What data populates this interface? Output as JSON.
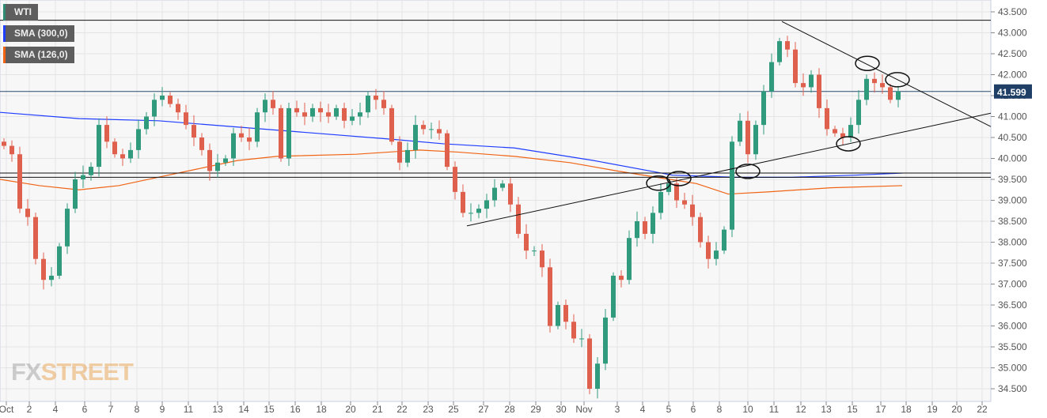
{
  "legend": [
    {
      "label": "WTI",
      "color": "#2e8a72"
    },
    {
      "label": "SMA (300,0)",
      "color": "#1f3dff"
    },
    {
      "label": "SMA (126,0)",
      "color": "#f06414"
    }
  ],
  "watermark": {
    "a": "FX",
    "b": "STREET"
  },
  "chart_data": {
    "type": "candlestick",
    "title": "WTI",
    "ylim": [
      34.3,
      43.8
    ],
    "y_ticks": [
      "43.500",
      "43.000",
      "42.500",
      "42.000",
      "41.500",
      "41.000",
      "40.500",
      "40.000",
      "39.500",
      "39.000",
      "38.500",
      "38.000",
      "37.500",
      "37.000",
      "36.500",
      "36.000",
      "35.500",
      "35.000",
      "34.500"
    ],
    "x_ticks": [
      {
        "label": "Oct",
        "i": 0.3
      },
      {
        "label": "2",
        "i": 3.2
      },
      {
        "label": "4",
        "i": 6.5
      },
      {
        "label": "6",
        "i": 10.2
      },
      {
        "label": "7",
        "i": 13.5
      },
      {
        "label": "8",
        "i": 16.8
      },
      {
        "label": "9",
        "i": 20
      },
      {
        "label": "11",
        "i": 23.3
      },
      {
        "label": "13",
        "i": 27
      },
      {
        "label": "14",
        "i": 30.3
      },
      {
        "label": "15",
        "i": 33.5
      },
      {
        "label": "16",
        "i": 36.8
      },
      {
        "label": "18",
        "i": 40.1
      },
      {
        "label": "20",
        "i": 43.8
      },
      {
        "label": "21",
        "i": 47.2
      },
      {
        "label": "22",
        "i": 50.3
      },
      {
        "label": "23",
        "i": 53.6
      },
      {
        "label": "25",
        "i": 56.8
      },
      {
        "label": "27",
        "i": 60.6
      },
      {
        "label": "28",
        "i": 63.9
      },
      {
        "label": "29",
        "i": 67.2
      },
      {
        "label": "30",
        "i": 70.4
      },
      {
        "label": "Nov",
        "i": 73.3
      },
      {
        "label": "3",
        "i": 77.5
      },
      {
        "label": "4",
        "i": 80.7
      },
      {
        "label": "5",
        "i": 84
      },
      {
        "label": "6",
        "i": 87.1
      },
      {
        "label": "8",
        "i": 90.4
      },
      {
        "label": "10",
        "i": 94
      },
      {
        "label": "11",
        "i": 97.3
      },
      {
        "label": "12",
        "i": 100.7
      },
      {
        "label": "13",
        "i": 103.9
      },
      {
        "label": "15",
        "i": 107.2
      },
      {
        "label": "17",
        "i": 110.8
      },
      {
        "label": "18",
        "i": 114
      },
      {
        "label": "19",
        "i": 117.3
      },
      {
        "label": "20",
        "i": 120.4
      },
      {
        "label": "22",
        "i": 123.6
      }
    ],
    "closes": [
      40.3,
      40.1,
      38.8,
      38.6,
      37.6,
      37.1,
      37.2,
      37.9,
      38.8,
      39.5,
      39.6,
      39.8,
      40.8,
      40.4,
      40.1,
      40.0,
      40.2,
      40.7,
      41.0,
      41.4,
      41.5,
      41.3,
      41.1,
      40.8,
      40.5,
      40.2,
      39.7,
      39.9,
      40.0,
      40.6,
      40.5,
      40.4,
      41.1,
      41.4,
      41.2,
      40.0,
      41.2,
      41.1,
      41.0,
      41.2,
      41.1,
      41.0,
      41.2,
      40.9,
      41.0,
      41.1,
      41.5,
      41.4,
      41.2,
      40.4,
      39.9,
      40.2,
      40.8,
      40.7,
      40.7,
      40.6,
      39.8,
      39.2,
      38.7,
      38.7,
      38.8,
      39.0,
      39.3,
      39.4,
      38.9,
      38.2,
      37.8,
      37.8,
      37.4,
      36.0,
      36.5,
      36.1,
      35.7,
      35.7,
      34.5,
      35.1,
      36.2,
      37.2,
      37.1,
      38.1,
      38.5,
      38.2,
      38.7,
      39.2,
      39.4,
      39.0,
      38.9,
      38.6,
      38.0,
      37.6,
      37.8,
      38.3,
      40.4,
      40.9,
      40.1,
      40.8,
      41.6,
      42.3,
      42.8,
      42.6,
      41.8,
      41.7,
      42.0,
      41.2,
      40.7,
      40.6,
      40.5,
      40.8,
      41.4,
      41.9,
      41.8,
      41.7,
      41.4,
      41.6
    ],
    "series": [
      {
        "name": "SMA (300,0)",
        "color": "#1f3dff",
        "points": [
          [
            -0.5,
            41.1
          ],
          [
            9.5,
            40.95
          ],
          [
            19.5,
            40.9
          ],
          [
            29.5,
            40.75
          ],
          [
            39.5,
            40.6
          ],
          [
            49.5,
            40.45
          ],
          [
            55.5,
            40.35
          ],
          [
            64.5,
            40.25
          ],
          [
            74.5,
            39.95
          ],
          [
            84.5,
            39.6
          ],
          [
            92.5,
            39.55
          ],
          [
            99.5,
            39.55
          ],
          [
            107.5,
            39.6
          ],
          [
            113.5,
            39.65
          ]
        ]
      },
      {
        "name": "SMA (126,0)",
        "color": "#f06414",
        "points": [
          [
            -0.5,
            39.5
          ],
          [
            4.5,
            39.35
          ],
          [
            9.5,
            39.25
          ],
          [
            14.5,
            39.35
          ],
          [
            19.5,
            39.55
          ],
          [
            24.5,
            39.75
          ],
          [
            29.5,
            39.95
          ],
          [
            34.5,
            40.05
          ],
          [
            44.5,
            40.1
          ],
          [
            52.5,
            40.2
          ],
          [
            57.5,
            40.15
          ],
          [
            64.5,
            40.05
          ],
          [
            71.5,
            39.9
          ],
          [
            77.5,
            39.7
          ],
          [
            82.5,
            39.55
          ],
          [
            87.5,
            39.4
          ],
          [
            91.5,
            39.15
          ],
          [
            96.5,
            39.2
          ],
          [
            104.5,
            39.3
          ],
          [
            113.5,
            39.35
          ]
        ]
      }
    ],
    "last_price": "41.599",
    "last_value": 41.599,
    "horizontal_levels": [
      43.3,
      39.65,
      39.55
    ],
    "trendlines": [
      [
        [
          58.5,
          38.39
        ],
        [
          124.7,
          41.08
        ]
      ],
      [
        [
          98.3,
          43.27
        ],
        [
          124.7,
          40.76
        ]
      ]
    ],
    "annotations_ellipses": [
      [
        82.7,
        39.41
      ],
      [
        85.3,
        39.52
      ],
      [
        94,
        39.69
      ],
      [
        106.7,
        40.35
      ],
      [
        109.1,
        42.27
      ],
      [
        112.9,
        41.88
      ]
    ],
    "colors": {
      "up": "#2f9a7c",
      "down": "#e0604e"
    }
  }
}
